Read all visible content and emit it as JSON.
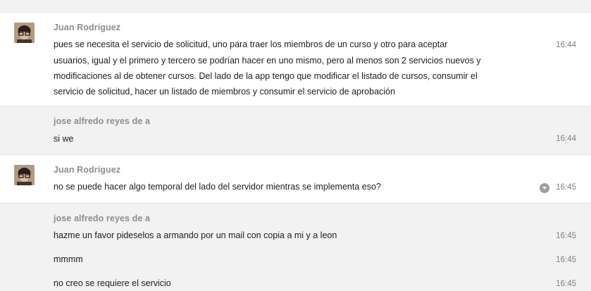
{
  "messages": [
    {
      "sender": "Juan Rodríguez",
      "lines": [
        "pues se necesita el servicio de solicitud, uno para traer los miembros de un curso y otro para aceptar",
        "usuarios, igual y el primero y tercero se podrían hacer en uno mismo, pero al menos son 2 servicios nuevos y",
        "modificaciones al de obtener cursos. Del lado de la app tengo que modificar el listado de cursos, consumir el",
        "servicio de solicitud, hacer un listado de miembros y consumir el servicio de aprobación"
      ],
      "time": "16:44"
    },
    {
      "sender": "jose alfredo reyes de a",
      "lines": [
        "si we"
      ],
      "time": "16:44"
    },
    {
      "sender": "Juan Rodríguez",
      "lines": [
        "no se puede hacer algo temporal del lado del servidor mientras se implementa eso?"
      ],
      "time": "16:45"
    },
    {
      "sender": "jose alfredo reyes de a",
      "items": [
        {
          "text": "hazme un favor pideselos a armando por un mail con copia a mi y a leon",
          "time": "16:45"
        },
        {
          "text": "mmmm",
          "time": "16:45"
        },
        {
          "text": "no creo se requiere el servicio",
          "time": "16:45"
        }
      ]
    }
  ],
  "icons": {
    "avatar": "user-avatar-photo",
    "status": "chevron-down-circle-icon"
  },
  "colors": {
    "sender_name": "#8d8d8d",
    "alt_background": "#f2f2f2",
    "timestamp": "#808080"
  }
}
